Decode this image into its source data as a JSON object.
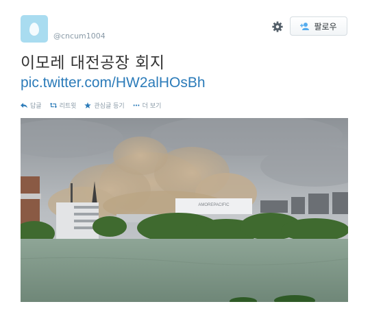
{
  "tweet": {
    "handle": "@cncum1004",
    "text": "이모레 대전공장 회지",
    "link": "pic.twitter.com/HW2alHOsBh"
  },
  "header": {
    "follow_label": "팔로우"
  },
  "actions": [
    {
      "label": "답글",
      "icon": "reply-icon"
    },
    {
      "label": "리트윗",
      "icon": "retweet-icon"
    },
    {
      "label": "관심글 등기",
      "icon": "favorite-star-icon"
    },
    {
      "label": "더 보기",
      "icon": "more-dots-icon"
    }
  ],
  "media": {
    "description": "",
    "sign_text": "AMOREPACIFIC"
  },
  "colors": {
    "link": "#2b7bb9",
    "meta": "#8899a6",
    "avatar_bg": "#a9dcf0"
  }
}
